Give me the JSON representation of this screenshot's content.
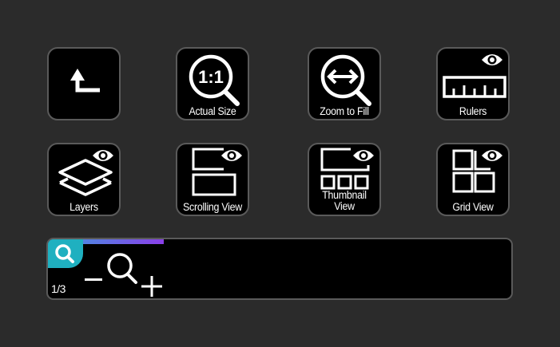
{
  "keys": {
    "back": {
      "label": "",
      "icon": "return-arrow-icon"
    },
    "actual_size": {
      "label": "Actual Size",
      "icon": "magnifier-1to1-icon",
      "glyph_text": "1:1"
    },
    "zoom_to_fill": {
      "label": "Zoom to Fill",
      "icon": "magnifier-horizontal-arrows-icon"
    },
    "rulers": {
      "label": "Rulers",
      "icon": "ruler-icon",
      "visibility_icon": "eye-icon"
    },
    "layers": {
      "label": "Layers",
      "icon": "layers-icon",
      "visibility_icon": "eye-icon"
    },
    "scrolling_view": {
      "label": "Scrolling View",
      "icon": "scrolling-view-icon",
      "visibility_icon": "eye-icon"
    },
    "thumbnail_view": {
      "label_line1": "Thumbnail",
      "label_line2": "View",
      "icon": "thumbnail-view-icon",
      "visibility_icon": "eye-icon"
    },
    "grid_view": {
      "label": "Grid View",
      "icon": "grid-view-icon",
      "visibility_icon": "eye-icon"
    }
  },
  "zoom_panel": {
    "page_indicator": "1/3",
    "progress": 0.25,
    "tab_icon": "search-icon",
    "controls": [
      "zoom-out-icon",
      "magnifier-icon",
      "zoom-in-icon"
    ]
  },
  "colors": {
    "background": "#2b2b2b",
    "key_fill": "#000000",
    "key_border": "#5a5a5a",
    "accent_tab": "#1fb0c0",
    "progress_start": "#3aa0e0",
    "progress_end": "#8a3fe8"
  }
}
